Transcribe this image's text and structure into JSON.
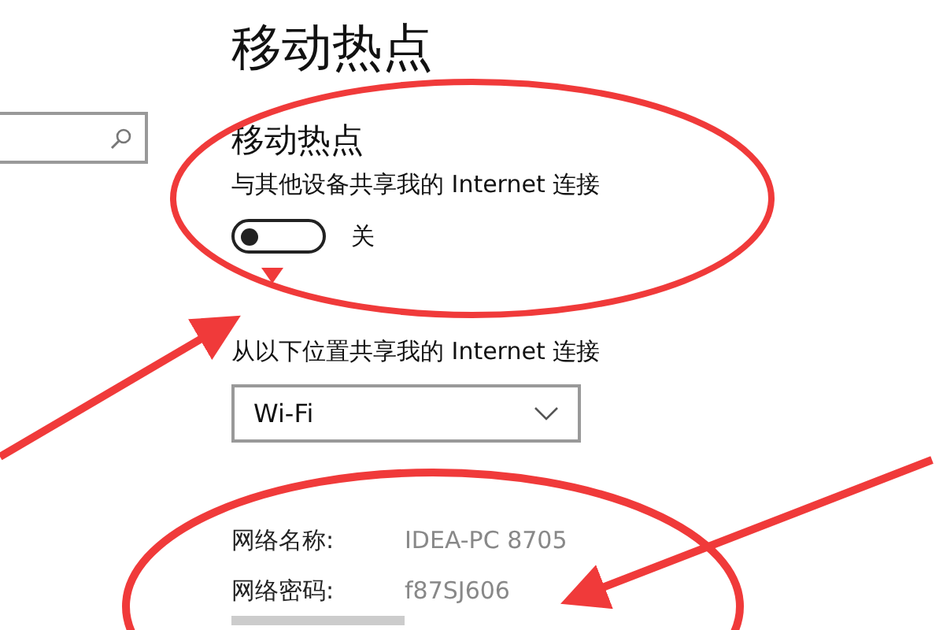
{
  "page": {
    "title": "移动热点"
  },
  "hotspot": {
    "heading": "移动热点",
    "description": "与其他设备共享我的 Internet 连接",
    "toggle": {
      "on": false,
      "label": "关"
    }
  },
  "share_from": {
    "label": "从以下位置共享我的 Internet 连接",
    "value": "Wi-Fi"
  },
  "network": [
    {
      "label": "网络名称:",
      "value": "IDEA-PC 8705"
    },
    {
      "label": "网络密码:",
      "value": "f87SJ606"
    }
  ]
}
